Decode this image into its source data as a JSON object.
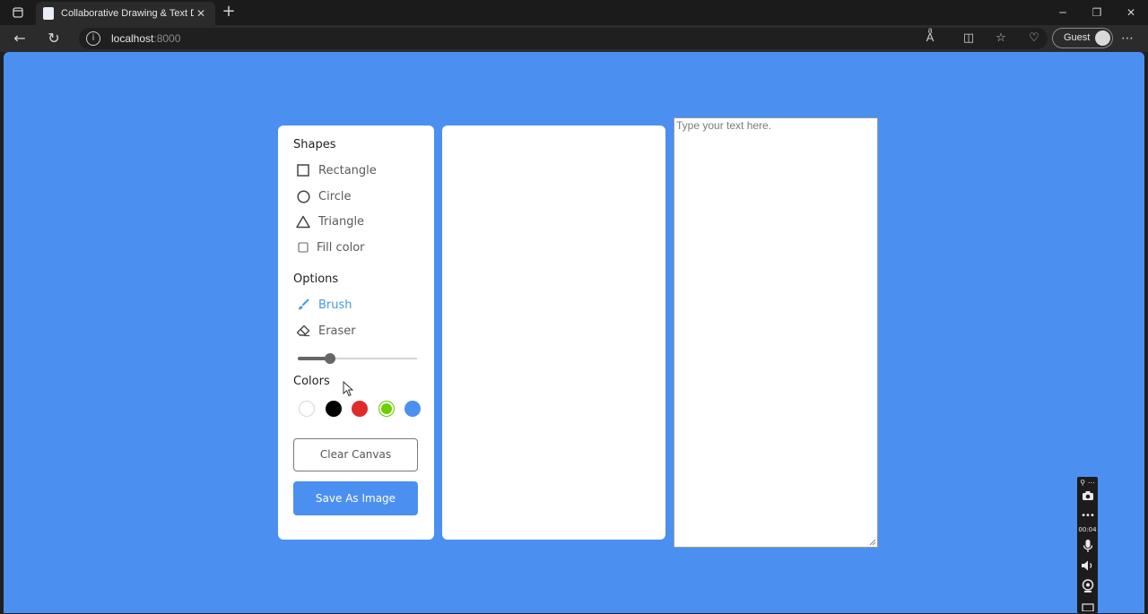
{
  "browser": {
    "tab_title": "Collaborative Drawing & Text Do",
    "url_host": "localhost",
    "url_port": ":8000",
    "profile_label": "Guest"
  },
  "sidebar": {
    "shapes_title": "Shapes",
    "shapes": [
      {
        "label": "Rectangle",
        "icon": "rectangle-icon"
      },
      {
        "label": "Circle",
        "icon": "circle-icon"
      },
      {
        "label": "Triangle",
        "icon": "triangle-icon"
      }
    ],
    "fill_color_label": "Fill color",
    "options_title": "Options",
    "tools": [
      {
        "label": "Brush",
        "icon": "brush-icon",
        "active": true
      },
      {
        "label": "Eraser",
        "icon": "eraser-icon",
        "active": false
      }
    ],
    "brush_size_fraction": 0.27,
    "colors_title": "Colors",
    "colors": [
      "#ffffff",
      "#000000",
      "#e02b2b",
      "#6ccf00",
      "#4b90f1"
    ],
    "selected_color_index": 3,
    "clear_label": "Clear Canvas",
    "save_label": "Save As Image"
  },
  "editor": {
    "placeholder": "Type your text here."
  },
  "recorder": {
    "timer": "00:04"
  },
  "theme": {
    "page_bg": "#4b90f1",
    "accent": "#4a98e0"
  }
}
